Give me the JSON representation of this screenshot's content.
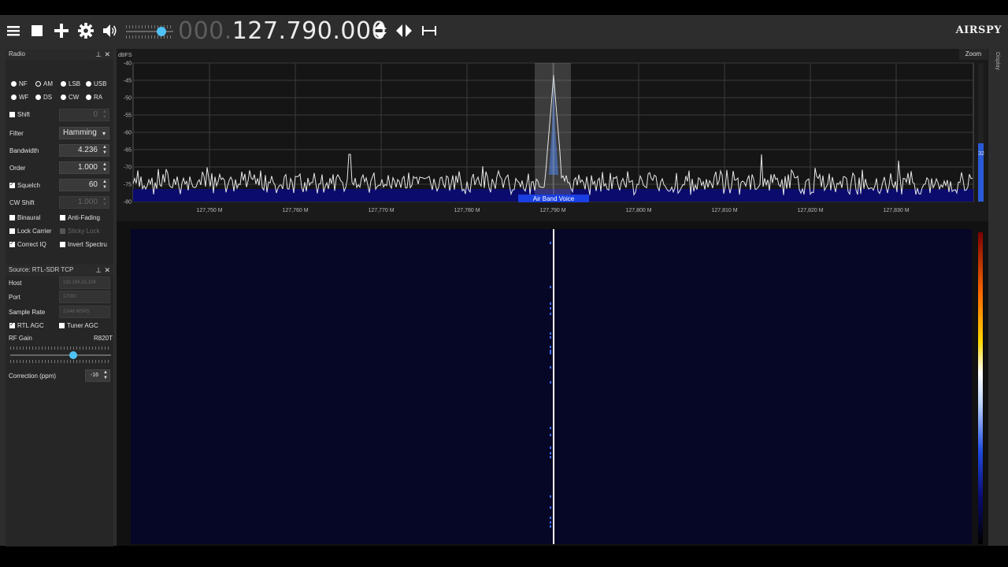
{
  "toolbar": {
    "icons": [
      "menu-icon",
      "stop-icon",
      "add-icon",
      "gear-icon",
      "speaker-icon",
      "freq-stepper-icon",
      "tuning-arrows-icon",
      "span-icon"
    ],
    "frequency_dim": "000.",
    "frequency_lit": "127.790.000",
    "brand": "AIRSPY",
    "volume_level": 0.72
  },
  "radio_panel": {
    "title": "Radio",
    "modes_row1": [
      "NF",
      "AM",
      "LSB",
      "USB"
    ],
    "modes_row2": [
      "WF",
      "DS",
      "CW",
      "RA"
    ],
    "selected_mode": "AM",
    "shift_label": "Shift",
    "shift_value": "0",
    "filter_label": "Filter",
    "filter_value": "Hamming",
    "bandwidth_label": "Bandwidth",
    "bandwidth_value": "4.236",
    "order_label": "Order",
    "order_value": "1.000",
    "squelch_label": "Squelch",
    "squelch_value": "60",
    "cwshift_label": "CW Shift",
    "cwshift_value": "1.000",
    "binaural_label": "Binaural",
    "antifading_label": "Anti-Fading",
    "lockcarrier_label": "Lock Carrier",
    "stickylock_label": "Sticky Lock",
    "correctiq_label": "Correct IQ",
    "invertspectrum_label": "Invert Spectru"
  },
  "source_panel": {
    "title": "Source: RTL-SDR TCP",
    "host_label": "Host",
    "host_value": "192.168.15.108",
    "port_label": "Port",
    "port_value": "17000",
    "samplerate_label": "Sample Rate",
    "samplerate_value": "2.048 MSPS",
    "rtlagc_label": "RTL AGC",
    "tuneragc_label": "Tuner AGC",
    "rfgain_label": "RF Gain",
    "rfgain_tuner": "R820T",
    "rfgain_level": 0.6,
    "correction_label": "Correction (ppm)",
    "correction_value": "-16"
  },
  "spectrum": {
    "ylabel": "dBFS",
    "y_ticks": [
      "-40",
      "-45",
      "-50",
      "-55",
      "-60",
      "-65",
      "-70",
      "-75",
      "-80"
    ],
    "x_ticks": [
      "127,750 M",
      "127,760 M",
      "127,770 M",
      "127,780 M",
      "127,790 M",
      "127,800 M",
      "127,810 M",
      "127,820 M",
      "127,830 M"
    ],
    "bookmark_label": "Air Band Voice",
    "side_value": "32",
    "zoom_label": "Zoom",
    "display_tab": "Display"
  }
}
